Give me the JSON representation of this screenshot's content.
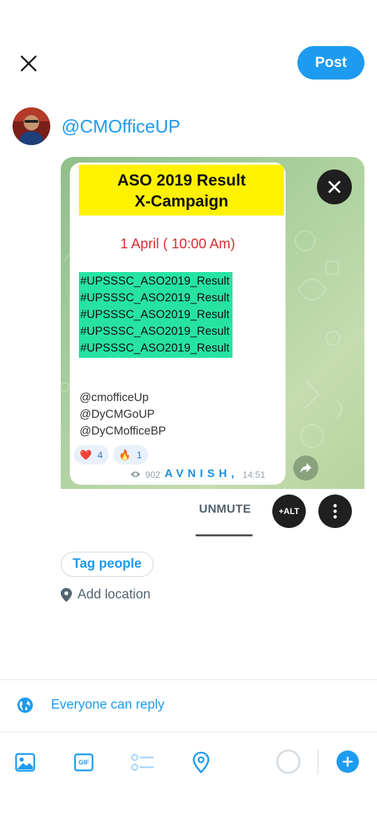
{
  "header": {
    "post_label": "Post",
    "close_icon": "close-icon"
  },
  "composer": {
    "handle": "@CMOfficeUP"
  },
  "media": {
    "telegram_message": {
      "title_line1": "ASO 2019 Result",
      "title_line2": "X-Campaign",
      "date_line": "1 April ( 10:00 Am)",
      "hashtags": [
        "#UPSSSC_ASO2019_Result",
        "#UPSSSC_ASO2019_Result",
        "#UPSSSC_ASO2019_Result",
        "#UPSSSC_ASO2019_Result",
        "#UPSSSC_ASO2019_Result"
      ],
      "mentions": [
        "@cmofficeUp",
        "@DyCMGoUP",
        "@DyCMofficeBP"
      ],
      "reactions": [
        {
          "emoji": "❤️",
          "count": "4"
        },
        {
          "emoji": "🔥",
          "count": "1"
        }
      ],
      "views": "902",
      "watermark": "AVNISH,",
      "time": "14:51"
    },
    "unmute_label": "UNMUTE",
    "alt_label": "+ALT"
  },
  "actions": {
    "tag_people": "Tag people",
    "add_location": "Add location"
  },
  "reply_setting": {
    "label": "Everyone can reply"
  },
  "toolbar": {
    "icons": [
      "image-icon",
      "gif-icon",
      "poll-icon",
      "location-pin-icon"
    ],
    "gif_label": "GIF"
  },
  "colors": {
    "accent": "#1d9bf0",
    "highlight_yellow": "#fff200",
    "highlight_green": "#27e3a2",
    "date_red": "#d32f2f"
  }
}
